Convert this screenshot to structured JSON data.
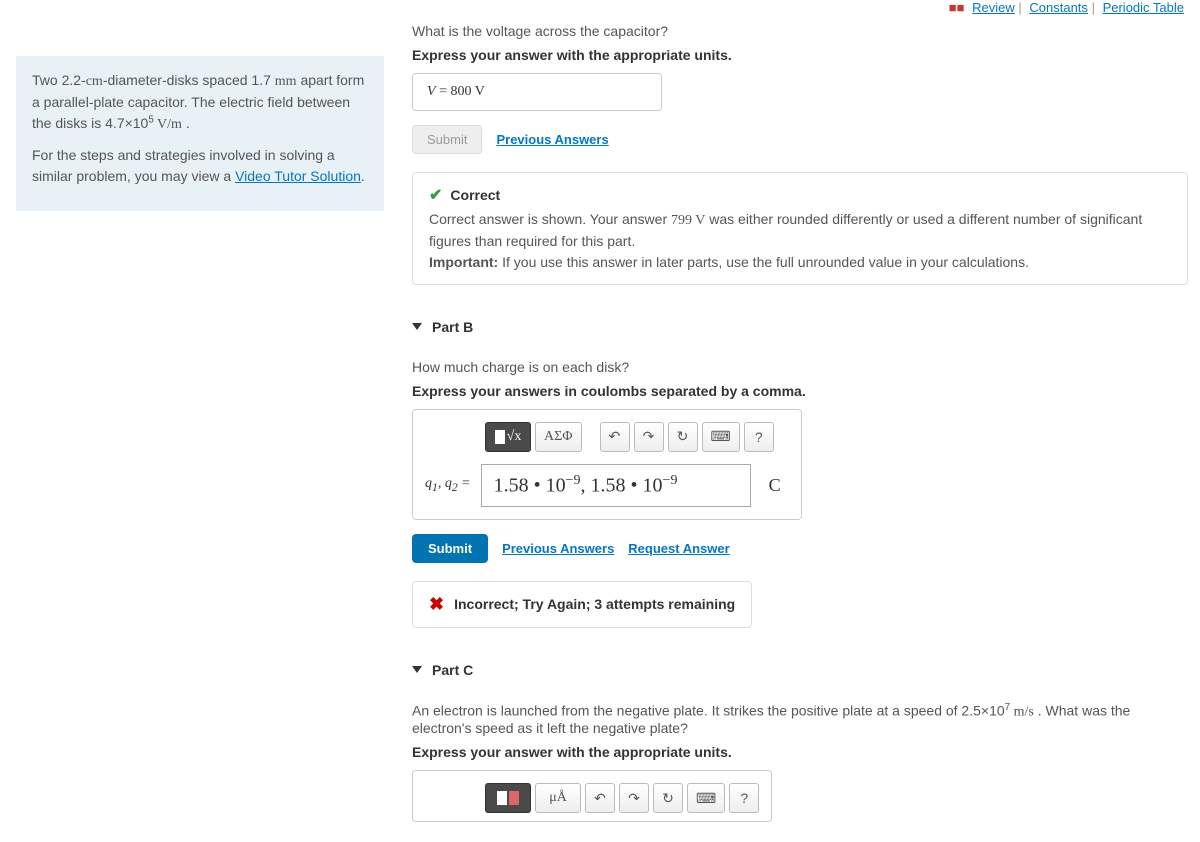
{
  "topnav": {
    "review": "Review",
    "constants": "Constants",
    "periodic": "Periodic Table"
  },
  "problem": {
    "text1_pre": "Two 2.2-",
    "text1_unit1": "cm",
    "text1_mid1": "-diameter-disks spaced 1.7 ",
    "text1_unit2": "mm",
    "text1_mid2": " apart form a parallel-plate capacitor. The electric field between the disks is 4.7×10",
    "text1_exp": "5",
    "text1_unit3": " V/m",
    "text1_end": " .",
    "text2_pre": "For the steps and strategies involved in solving a similar problem, you may view a ",
    "text2_link": "Video Tutor Solution",
    "text2_end": "."
  },
  "partA": {
    "question": "What is the voltage across the capacitor?",
    "instruct": "Express your answer with the appropriate units.",
    "var": "V",
    "eq": " = ",
    "value": "800 V",
    "submit": "Submit",
    "prev": "Previous Answers",
    "fb_title": "Correct",
    "fb_body_pre": "Correct answer is shown. Your answer ",
    "fb_body_val": "799 V",
    "fb_body_post": " was either rounded differently or used a different number of significant figures than required for this part.",
    "fb_important_label": "Important:",
    "fb_important_text": " If you use this answer in later parts, use the full unrounded value in your calculations."
  },
  "partB": {
    "header": "Part B",
    "question": "How much charge is on each disk?",
    "instruct": "Express your answers in coulombs separated by a comma.",
    "tool_sqrt": "√x",
    "tool_greek": "ΑΣΦ",
    "tool_undo": "↶",
    "tool_redo": "↷",
    "tool_reset": "↻",
    "tool_keyboard": "⌨",
    "tool_help": "?",
    "label_pre": "q",
    "label_sub1": "1",
    "label_sep": ", ",
    "label_sub2": "2",
    "label_eq": " = ",
    "input_value": "1.58 • 10⁻⁹, 1.58 • 10⁻⁹",
    "unit": "C",
    "submit": "Submit",
    "prev": "Previous Answers",
    "request": "Request Answer",
    "incorrect": "Incorrect; Try Again; 3 attempts remaining"
  },
  "partC": {
    "header": "Part C",
    "question_pre": "An electron is launched from the negative plate. It strikes the positive plate at a speed of 2.5×10",
    "question_exp": "7",
    "question_unit": " m/s",
    "question_post": " . What was the electron's speed as it left the negative plate?",
    "instruct": "Express your answer with the appropriate units.",
    "tool_units": "μÅ",
    "tool_undo": "↶",
    "tool_redo": "↷",
    "tool_reset": "↻",
    "tool_keyboard": "⌨",
    "tool_help": "?"
  },
  "chart_data": {
    "type": "table",
    "note": "physics homework interface, no chart present"
  }
}
